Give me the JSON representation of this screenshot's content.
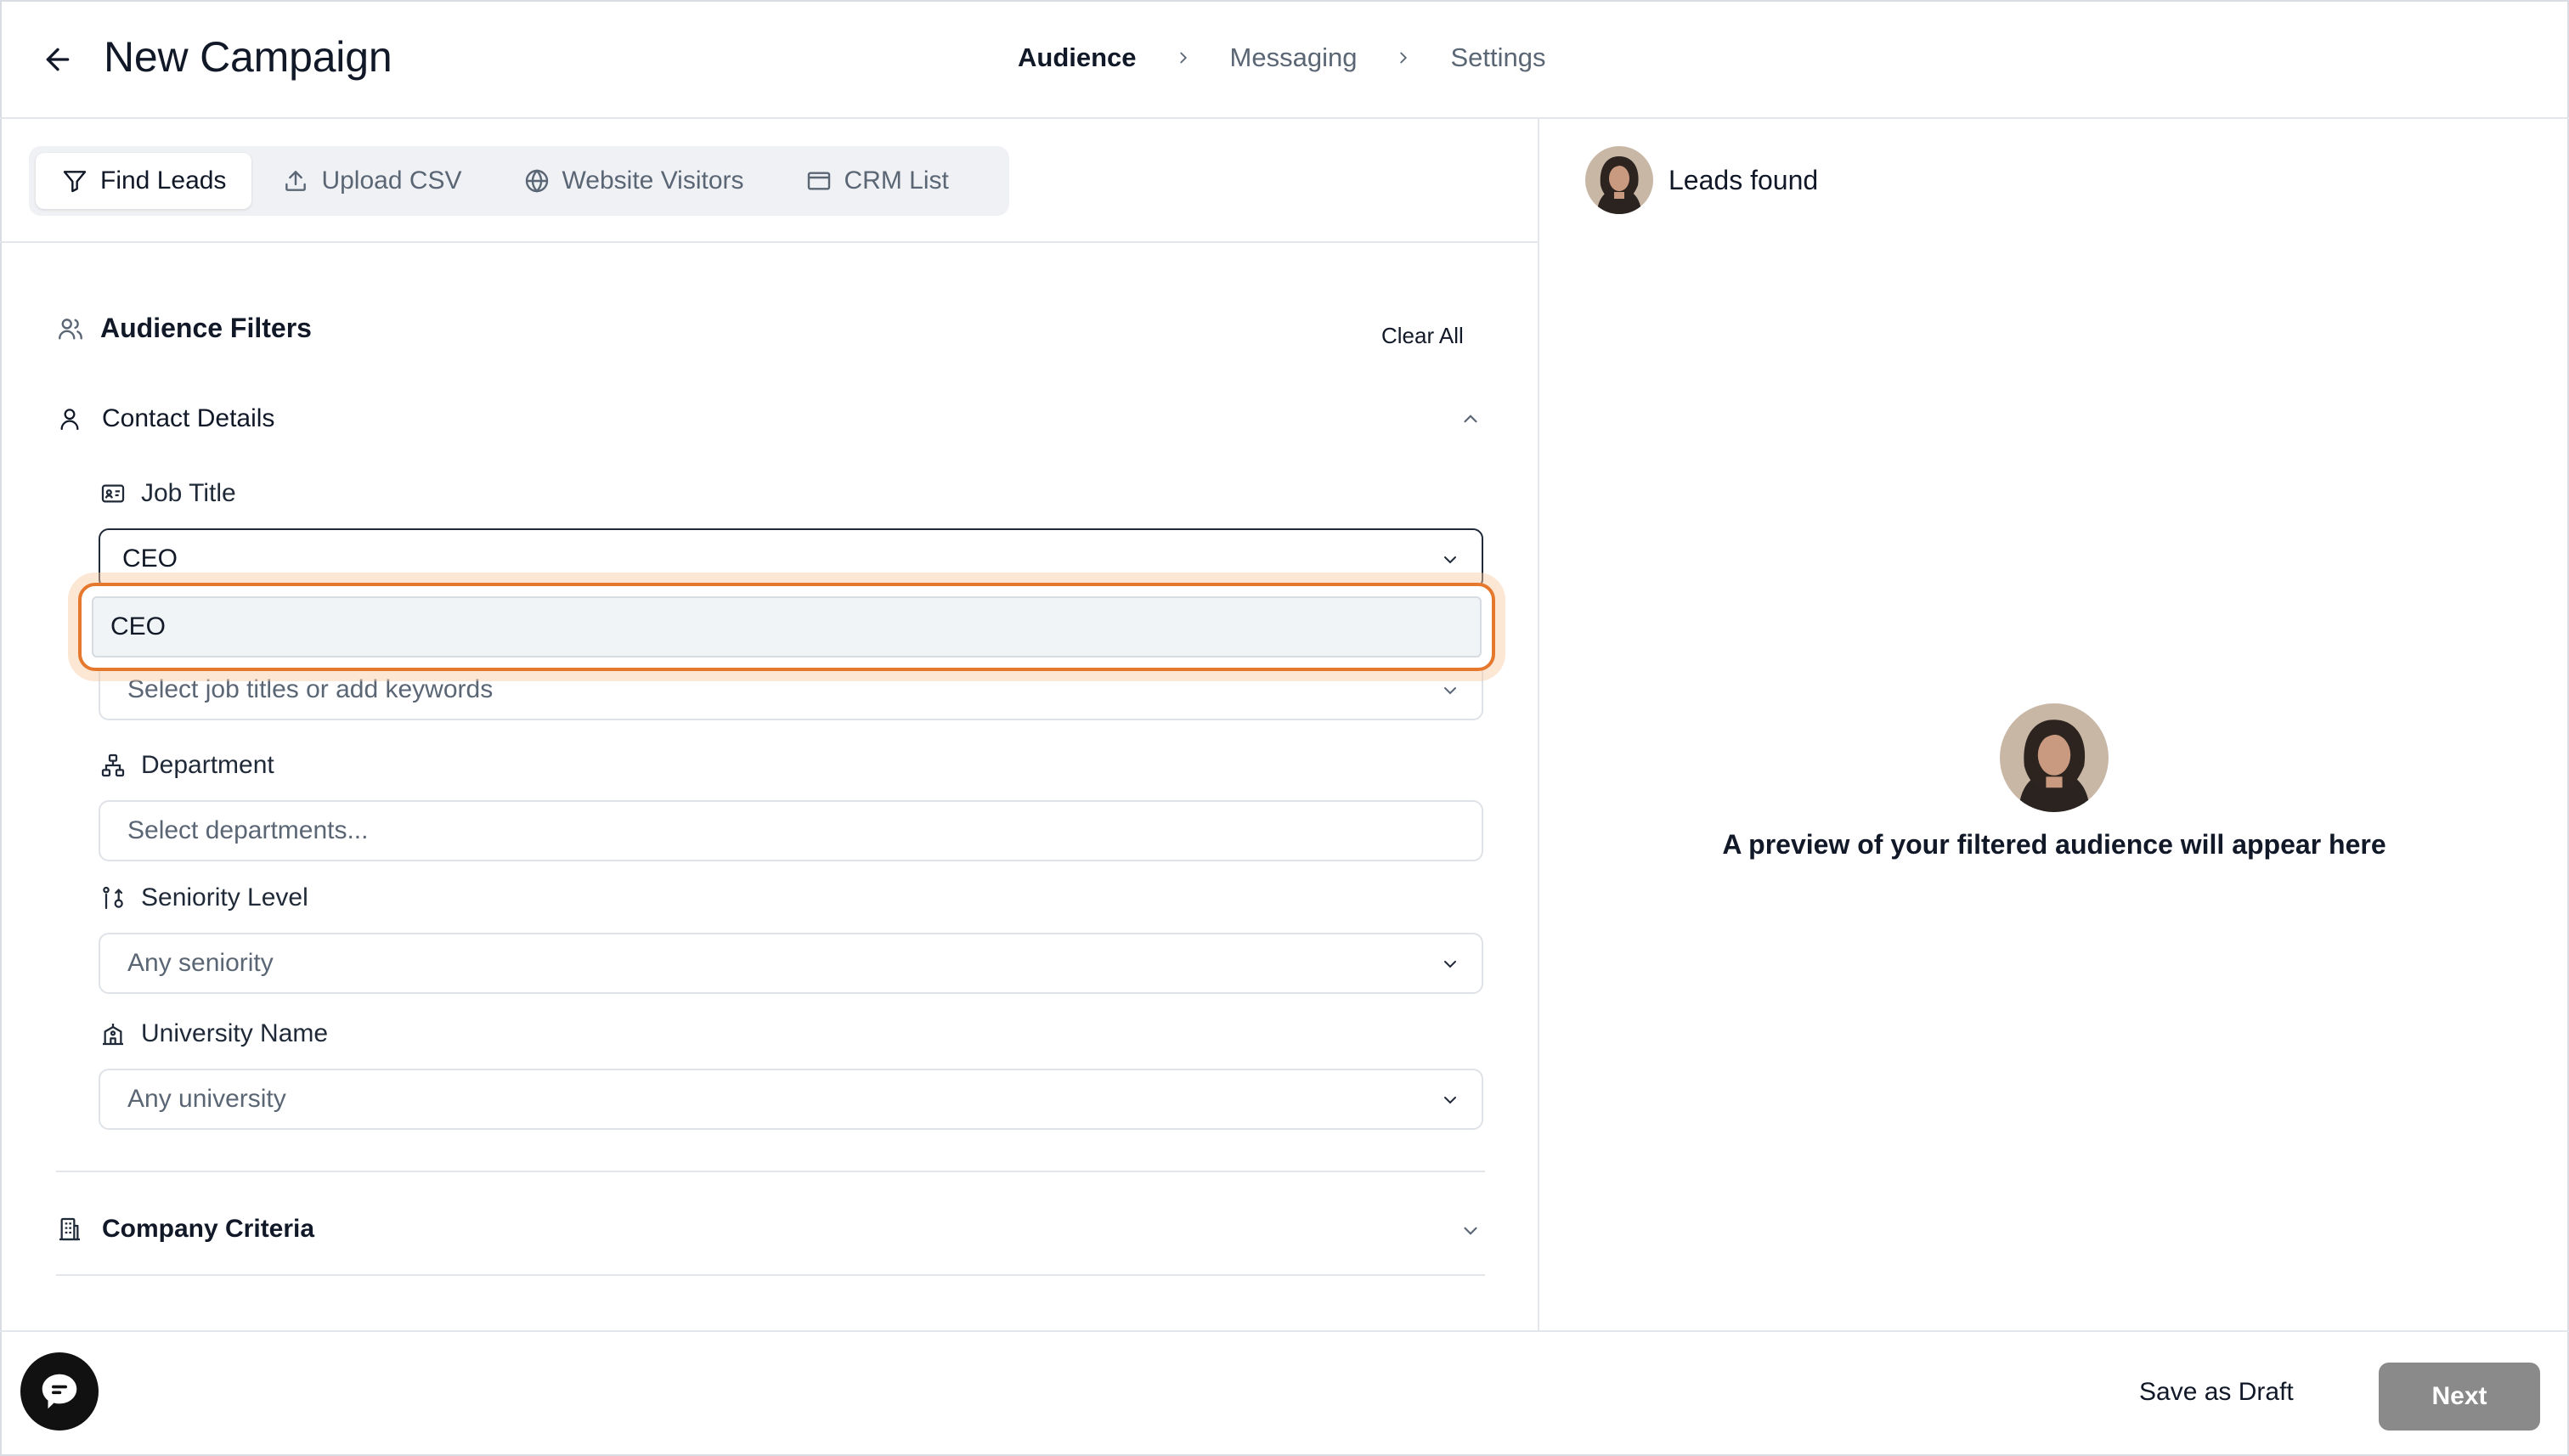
{
  "header": {
    "title": "New Campaign",
    "steps": [
      {
        "label": "Audience"
      },
      {
        "label": "Messaging"
      },
      {
        "label": "Settings"
      }
    ]
  },
  "source_tabs": [
    {
      "label": "Find Leads",
      "icon": "filter-icon"
    },
    {
      "label": "Upload CSV",
      "icon": "upload-icon"
    },
    {
      "label": "Website Visitors",
      "icon": "globe-icon"
    },
    {
      "label": "CRM List",
      "icon": "browser-icon"
    }
  ],
  "filters": {
    "title": "Audience Filters",
    "clear_all": "Clear All",
    "contact_details": {
      "label": "Contact Details",
      "job_title": {
        "label": "Job Title",
        "value": "CEO",
        "dropdown_option": "CEO",
        "placeholder": "Select job titles or add keywords"
      },
      "department": {
        "label": "Department",
        "placeholder": "Select departments..."
      },
      "seniority": {
        "label": "Seniority Level",
        "value": "Any seniority"
      },
      "university": {
        "label": "University Name",
        "value": "Any university"
      }
    },
    "company_criteria": {
      "label": "Company Criteria"
    }
  },
  "preview": {
    "leads_found": "Leads found",
    "message": "A preview of your filtered audience will appear here"
  },
  "footer": {
    "save_draft": "Save as Draft",
    "next": "Next"
  },
  "colors": {
    "accent_highlight": "#e6782e",
    "next_disabled": "#8a8a8a"
  }
}
